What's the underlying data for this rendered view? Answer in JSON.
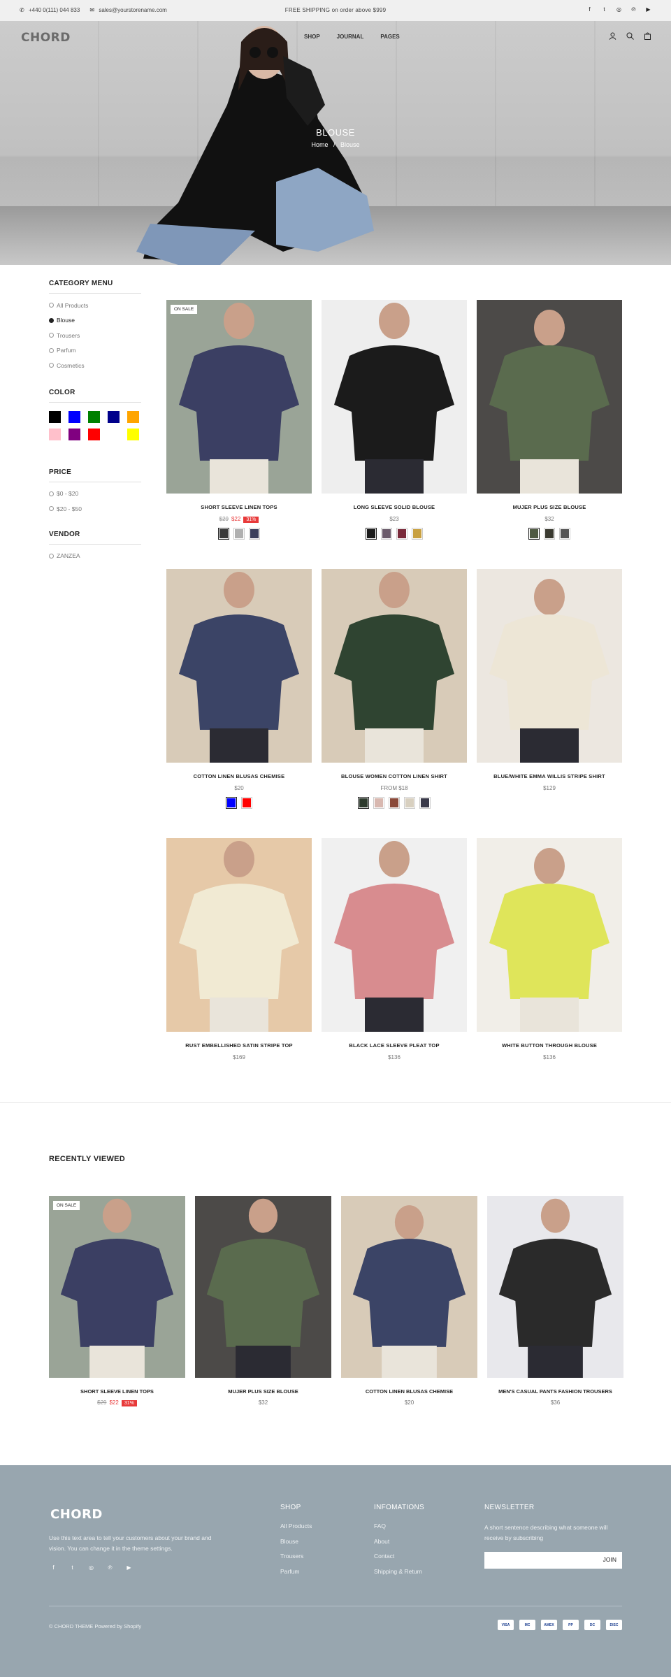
{
  "topbar": {
    "phone": "+440 0(111) 044 833",
    "email": "sales@yourstorename.com",
    "shipping": "FREE SHIPPING on order above $999",
    "social": [
      "facebook-icon",
      "twitter-icon",
      "instagram-icon",
      "pinterest-icon",
      "youtube-icon"
    ]
  },
  "nav": {
    "logo": "CHORD",
    "menu": [
      "SHOP",
      "JOURNAL",
      "PAGES"
    ],
    "icons": [
      "account-icon",
      "search-icon",
      "cart-icon"
    ]
  },
  "hero": {
    "title": "BLOUSE",
    "breadcrumb_home": "Home",
    "breadcrumb_sep": "/",
    "breadcrumb_current": "Blouse"
  },
  "sidebar": {
    "category_title": "CATEGORY MENU",
    "categories": [
      {
        "label": "All Products",
        "selected": false
      },
      {
        "label": "Blouse",
        "selected": true
      },
      {
        "label": "Trousers",
        "selected": false
      },
      {
        "label": "Parfum",
        "selected": false
      },
      {
        "label": "Cosmetics",
        "selected": false
      }
    ],
    "color_title": "COLOR",
    "colors": [
      "#000000",
      "#0000ff",
      "#008000",
      "#00008b",
      "#ffa500",
      "#ffc0cb",
      "#800080",
      "#ff0000",
      "#ffffff",
      "#ffff00"
    ],
    "price_title": "PRICE",
    "prices": [
      "$0 - $20",
      "$20 - $50"
    ],
    "vendor_title": "VENDOR",
    "vendors": [
      "ZANZEA"
    ]
  },
  "products": [
    {
      "name": "SHORT SLEEVE LINEN TOPS",
      "old": "$29",
      "price": "$22",
      "pct": "31%",
      "badge": "ON SALE",
      "thumbs": [
        "#3a3a3a",
        "#b0b0b0",
        "#3b3f5c"
      ],
      "bg": "#9aa497",
      "cloth": "#3b3f63"
    },
    {
      "name": "LONG SLEEVE SOLID BLOUSE",
      "price": "$23",
      "thumbs": [
        "#1a1a1a",
        "#6a5a6a",
        "#7a2a3a",
        "#c8a040"
      ],
      "bg": "#eeeeee",
      "cloth": "#1b1b1b"
    },
    {
      "name": "MUJER PLUS SIZE BLOUSE",
      "price": "$32",
      "thumbs": [
        "#4f5a42",
        "#3a3a30",
        "#555555"
      ],
      "bg": "#4c4a48",
      "cloth": "#5a6b4e"
    },
    {
      "name": "COTTON LINEN BLUSAS CHEMISE",
      "price": "$20",
      "swatches": [
        "#0000ff",
        "#ff0000"
      ],
      "bg": "#d8cbb8",
      "cloth": "#3b4466"
    },
    {
      "name": "BLOUSE WOMEN COTTON LINEN SHIRT",
      "price": "FROM $18",
      "thumbs": [
        "#2e3b2e",
        "#d8b8b0",
        "#8a4a3a",
        "#d8d0c0",
        "#3a3a4a"
      ],
      "bg": "#d8cbb8",
      "cloth": "#2f4431"
    },
    {
      "name": "BLUE/WHITE EMMA WILLIS STRIPE SHIRT",
      "price": "$129",
      "bg": "#ece7e0",
      "cloth": "#ede6d6"
    },
    {
      "name": "RUST EMBELLISHED SATIN STRIPE TOP",
      "price": "$169",
      "bg": "#e6c9a8",
      "cloth": "#f1ead3"
    },
    {
      "name": "BLACK LACE SLEEVE PLEAT TOP",
      "price": "$136",
      "bg": "#f0f0f0",
      "cloth": "#d88c8f"
    },
    {
      "name": "WHITE BUTTON THROUGH BLOUSE",
      "price": "$136",
      "bg": "#f1eee8",
      "cloth": "#dfe55a"
    }
  ],
  "recently": {
    "title": "RECENTLY VIEWED",
    "items": [
      {
        "name": "SHORT SLEEVE LINEN TOPS",
        "old": "$29",
        "price": "$22",
        "pct": "31%",
        "badge": "ON SALE",
        "bg": "#9aa497",
        "cloth": "#3b3f63"
      },
      {
        "name": "MUJER PLUS SIZE BLOUSE",
        "price": "$32",
        "bg": "#4c4a48",
        "cloth": "#5a6b4e"
      },
      {
        "name": "COTTON LINEN BLUSAS CHEMISE",
        "price": "$20",
        "bg": "#d8cbb8",
        "cloth": "#3b4466"
      },
      {
        "name": "MEN'S CASUAL PANTS FASHION TROUSERS",
        "price": "$36",
        "bg": "#e8e8ec",
        "cloth": "#2a2a2a"
      }
    ]
  },
  "footer": {
    "logo": "CHORD",
    "desc": "Use this text area to tell your customers about your brand and vision. You can change it in the theme settings.",
    "shop_title": "SHOP",
    "shop_links": [
      "All Products",
      "Blouse",
      "Trousers",
      "Parfum"
    ],
    "info_title": "INFOMATIONS",
    "info_links": [
      "FAQ",
      "About",
      "Contact",
      "Shipping & Return"
    ],
    "news_title": "NEWSLETTER",
    "news_text": "A short sentence describing what someone will receive by subscribing",
    "join": "JOIN",
    "copyright": "© CHORD THEME",
    "powered": "Powered by Shopify",
    "payments": [
      "VISA",
      "MC",
      "AMEX",
      "PP",
      "DC",
      "DISC"
    ]
  }
}
